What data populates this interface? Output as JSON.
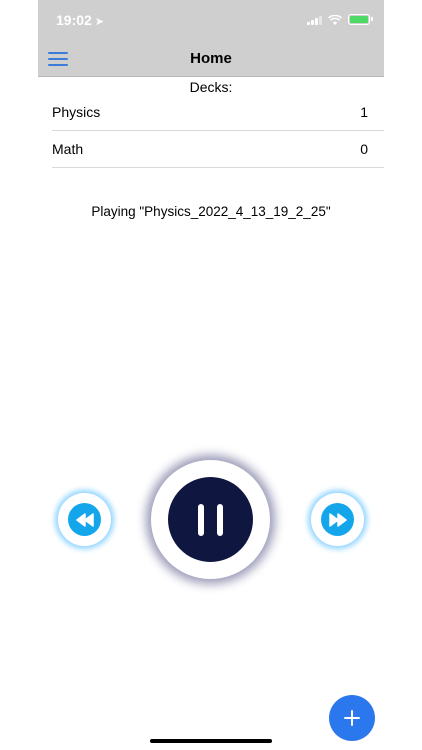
{
  "status_bar": {
    "time": "19:02",
    "location_icon": "location-arrow-icon"
  },
  "nav": {
    "title": "Home",
    "menu_icon": "hamburger-menu-icon"
  },
  "decks": {
    "header": "Decks:",
    "items": [
      {
        "name": "Physics",
        "count": "1"
      },
      {
        "name": "Math",
        "count": "0"
      }
    ]
  },
  "player": {
    "status_text": "Playing \"Physics_2022_4_13_19_2_25\"",
    "rewind_icon": "rewind-icon",
    "pause_icon": "pause-icon",
    "forward_icon": "fast-forward-icon"
  },
  "fab": {
    "label": "+",
    "icon": "plus-icon"
  },
  "colors": {
    "accent": "#2b78ee",
    "menu": "#3d7bd9",
    "control_blue": "#14a6ea",
    "play_dark": "#0f1740",
    "header_gray": "#cfcfcf",
    "battery_green": "#4cd964"
  }
}
